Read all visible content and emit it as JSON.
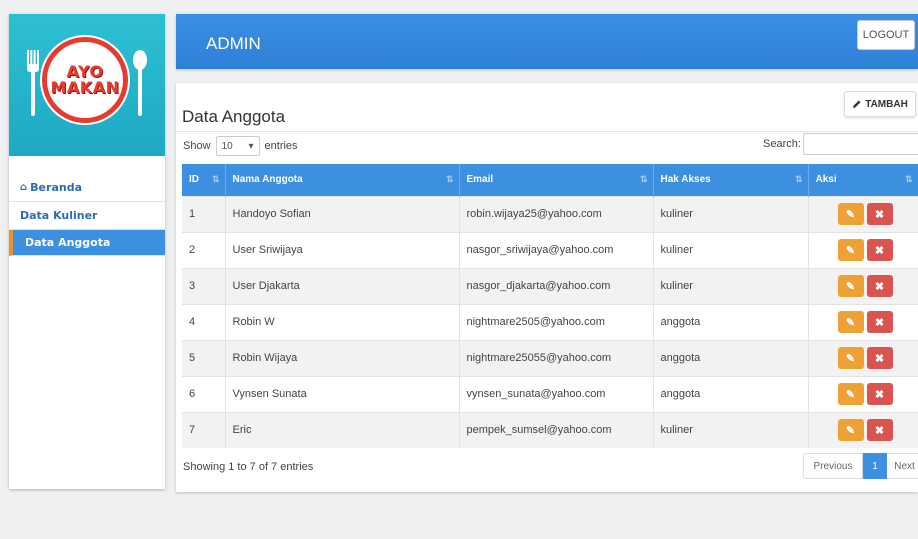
{
  "logo": {
    "line1": "AYO",
    "line2": "MAKAN"
  },
  "sidebar": {
    "items": [
      {
        "label": "Beranda",
        "icon": "home-icon"
      },
      {
        "label": "Data Kuliner"
      },
      {
        "label": "Data Anggota"
      }
    ]
  },
  "header": {
    "title": "ADMIN",
    "logout_label": "LOGOUT"
  },
  "panel": {
    "title": "Data Anggota",
    "add_label": "TAMBAH",
    "show_label": "Show",
    "entries_label": "entries",
    "length_value": "10",
    "search_label": "Search:",
    "search_value": ""
  },
  "table": {
    "columns": [
      "ID",
      "Nama Anggota",
      "Email",
      "Hak Akses",
      "Aksi"
    ],
    "rows": [
      {
        "id": "1",
        "name": "Handoyo Sofian",
        "email": "robin.wijaya25@yahoo.com",
        "role": "kuliner"
      },
      {
        "id": "2",
        "name": "User Sriwijaya",
        "email": "nasgor_sriwijaya@yahoo.com",
        "role": "kuliner"
      },
      {
        "id": "3",
        "name": "User Djakarta",
        "email": "nasgor_djakarta@yahoo.com",
        "role": "kuliner"
      },
      {
        "id": "4",
        "name": "Robin W",
        "email": "nightmare2505@yahoo.com",
        "role": "anggota"
      },
      {
        "id": "5",
        "name": "Robin Wijaya",
        "email": "nightmare25055@yahoo.com",
        "role": "anggota"
      },
      {
        "id": "6",
        "name": "Vynsen Sunata",
        "email": "vynsen_sunata@yahoo.com",
        "role": "anggota"
      },
      {
        "id": "7",
        "name": "Eric",
        "email": "pempek_sumsel@yahoo.com",
        "role": "kuliner"
      }
    ]
  },
  "footer": {
    "info": "Showing 1 to 7 of 7 entries",
    "prev_label": "Previous",
    "current_page": "1",
    "next_label": "Next"
  },
  "colors": {
    "primary": "#3d8fe0",
    "sidebar_header": "#2cc0d3",
    "edit": "#eea236",
    "delete": "#d9534f",
    "active_border": "#e8922b"
  }
}
